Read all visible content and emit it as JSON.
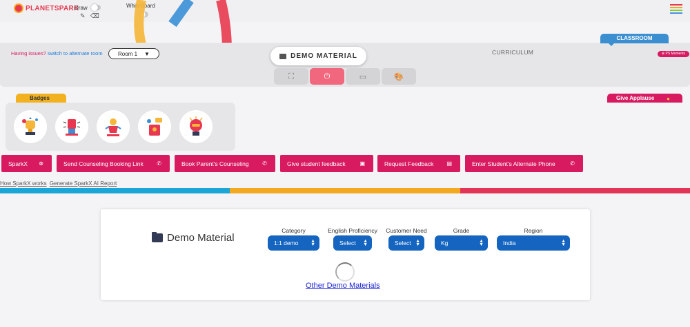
{
  "app": {
    "logo_text": "PLANETSPARK",
    "draw_label": "Draw",
    "whiteboard_label": "WhiteBoard",
    "menu_icon": "hamburger-menu-icon",
    "menu_colors": [
      "#e8384f",
      "#f5a623",
      "#7ed321",
      "#4a90e2"
    ]
  },
  "room_panel": {
    "issue_text": "Having issues?",
    "issue_link": "switch to alternate room",
    "room_value": "Room 1",
    "demo_button": "DEMO MATERIAL",
    "curriculum": "CURRICULUM",
    "classroom_tab": "CLASSROOM",
    "ps_moments": "PS Moments",
    "controls": [
      {
        "icon": "fullscreen-icon",
        "glyph": "⛶",
        "active": false
      },
      {
        "icon": "power-icon",
        "glyph": "⏻",
        "active": true
      },
      {
        "icon": "screen-icon",
        "glyph": "▭",
        "active": false
      },
      {
        "icon": "palette-icon",
        "glyph": "🎨",
        "active": false
      }
    ]
  },
  "badges": {
    "tab_label": "Badges",
    "items": [
      {
        "icon": "trophy-badge-icon"
      },
      {
        "icon": "fist-badge-icon"
      },
      {
        "icon": "superhero-badge-icon"
      },
      {
        "icon": "idea-badge-icon"
      },
      {
        "icon": "thinker-badge-icon"
      }
    ]
  },
  "applause": {
    "label": "Give Applause",
    "icon": "clapping-hands-icon"
  },
  "actions": [
    {
      "label": "SparkX",
      "icon": "close-circle-icon",
      "glyph": "⊗"
    },
    {
      "label": "Send Counseling Booking Link",
      "icon": "phone-icon",
      "glyph": "✆"
    },
    {
      "label": "Book Parent's Counseling",
      "icon": "phone-icon",
      "glyph": "✆"
    },
    {
      "label": "Give student feedback",
      "icon": "feedback-icon",
      "glyph": "▣"
    },
    {
      "label": "Request Feedback",
      "icon": "document-icon",
      "glyph": "▤"
    },
    {
      "label": "Enter Student's Alternate Phone",
      "icon": "phone-icon",
      "glyph": "✆"
    }
  ],
  "links": {
    "how_sparkx": "How SparkX works",
    "generate_report": "Generate SparkX AI Report"
  },
  "stripe_colors": [
    "#1aa7d8",
    "#f2a91f",
    "#e23556"
  ],
  "demo_card": {
    "title": "Demo Material",
    "filters": [
      {
        "label": "Category",
        "value": "1:1 demo"
      },
      {
        "label": "English Proficiency",
        "value": "Select"
      },
      {
        "label": "Customer Need",
        "value": "Select"
      },
      {
        "label": "Grade",
        "value": "Kg"
      },
      {
        "label": "Region",
        "value": "India"
      }
    ],
    "other_link": "Other Demo Materials"
  }
}
